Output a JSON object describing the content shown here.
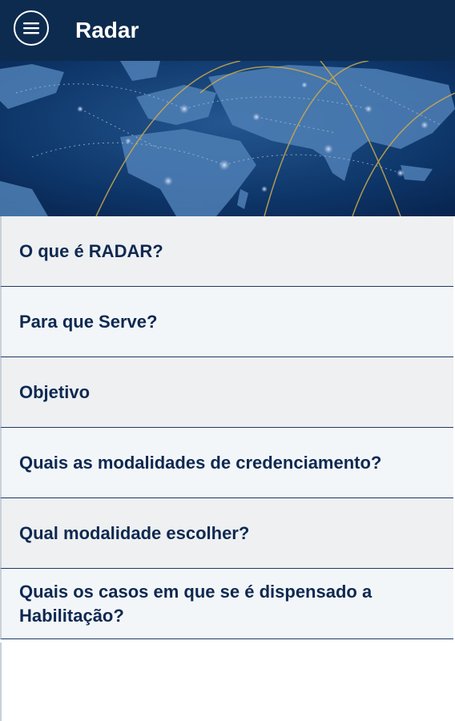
{
  "appbar": {
    "title": "Radar",
    "menu_icon": "hamburger-menu-icon",
    "background": "#0d2b4e"
  },
  "banner": {
    "image": "world-map-network-banner"
  },
  "menu": {
    "items": [
      {
        "label": "O que é RADAR?"
      },
      {
        "label": "Para que Serve?"
      },
      {
        "label": "Objetivo"
      },
      {
        "label": "Quais as modalidades de credenciamento?"
      },
      {
        "label": "Qual modalidade escolher?"
      },
      {
        "label": "Quais os casos em que se é dispensado a Habilitação?"
      }
    ]
  },
  "colors": {
    "text_primary": "#0e2950",
    "divider": "#1d3a63"
  }
}
